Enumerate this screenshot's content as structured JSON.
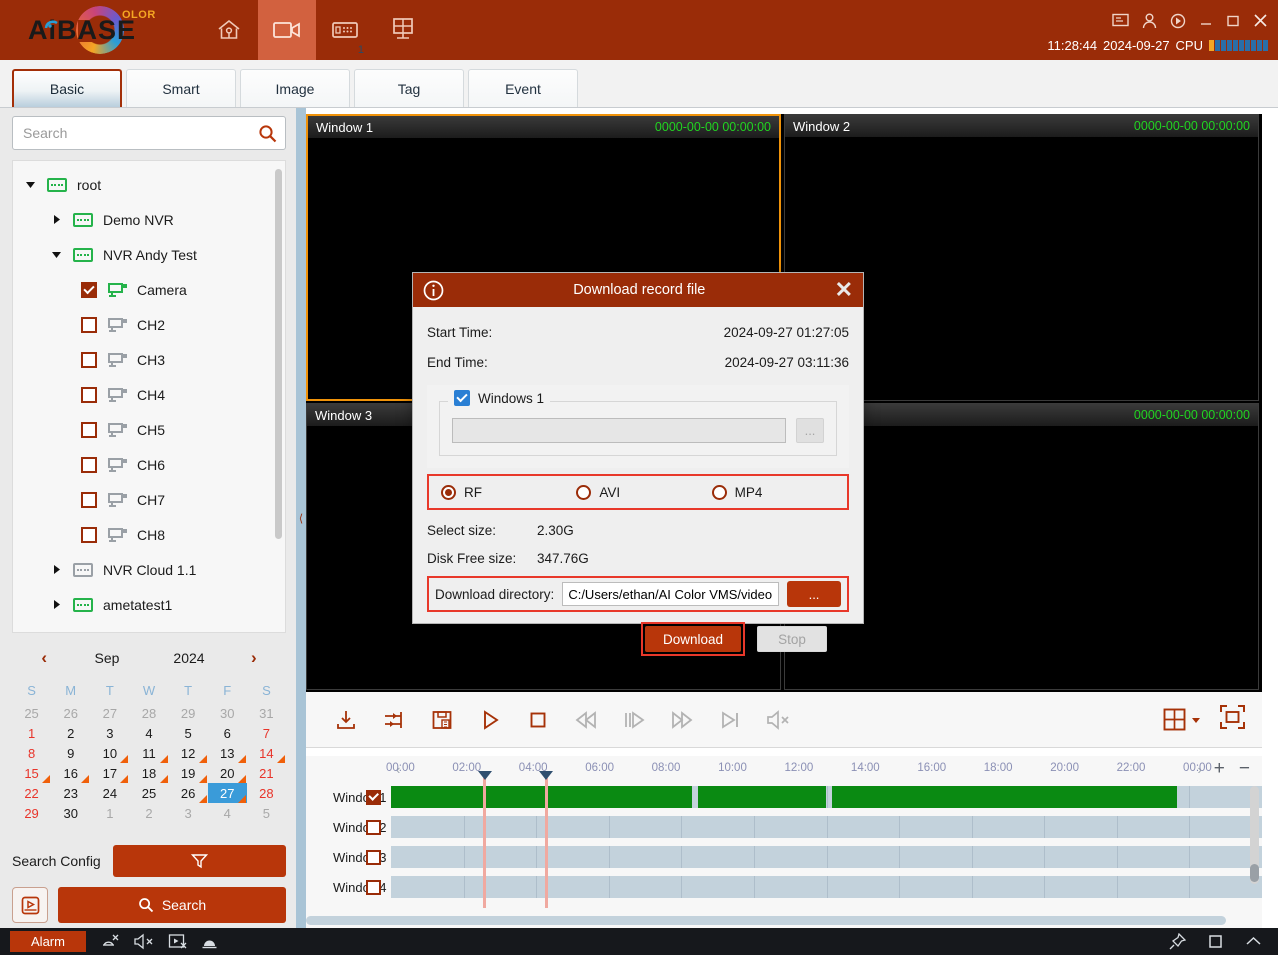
{
  "header": {
    "brand": "AiBASE",
    "brand_suffix": "OLOR",
    "nav": [
      {
        "name": "home-icon",
        "label": "Home",
        "active": false
      },
      {
        "name": "playback-camera-icon",
        "label": "Playback",
        "active": true
      },
      {
        "name": "device-icon",
        "label": "Device",
        "active": false
      },
      {
        "name": "layout-icon",
        "label": "Layout",
        "active": false
      }
    ],
    "nav_badge": "1",
    "window_controls": [
      "monitor-icon",
      "user-icon",
      "power-icon",
      "minimize-icon",
      "maximize-icon",
      "close-icon"
    ],
    "time": "11:28:44",
    "date": "2024-09-27",
    "cpu_label": "CPU",
    "cpu_bars": 10,
    "cpu_hot_bars": 1,
    "accent": "#9a2c08"
  },
  "tabs": [
    {
      "label": "Basic",
      "active": true
    },
    {
      "label": "Smart",
      "active": false
    },
    {
      "label": "Image",
      "active": false
    },
    {
      "label": "Tag",
      "active": false
    },
    {
      "label": "Event",
      "active": false
    }
  ],
  "sidebar": {
    "search_placeholder": "Search",
    "search_value": "",
    "tree": [
      {
        "label": "root",
        "depth": 0,
        "type": "nvr",
        "online": true,
        "expanded": true
      },
      {
        "label": "Demo NVR",
        "depth": 1,
        "type": "nvr",
        "online": true,
        "expanded": false
      },
      {
        "label": "NVR Andy Test",
        "depth": 1,
        "type": "nvr",
        "online": true,
        "expanded": true
      },
      {
        "label": "Camera",
        "depth": 2,
        "type": "camera",
        "online": true,
        "checked": true
      },
      {
        "label": "CH2",
        "depth": 2,
        "type": "camera",
        "online": false,
        "checked": false
      },
      {
        "label": "CH3",
        "depth": 2,
        "type": "camera",
        "online": false,
        "checked": false
      },
      {
        "label": "CH4",
        "depth": 2,
        "type": "camera",
        "online": false,
        "checked": false
      },
      {
        "label": "CH5",
        "depth": 2,
        "type": "camera",
        "online": false,
        "checked": false
      },
      {
        "label": "CH6",
        "depth": 2,
        "type": "camera",
        "online": false,
        "checked": false
      },
      {
        "label": "CH7",
        "depth": 2,
        "type": "camera",
        "online": false,
        "checked": false
      },
      {
        "label": "CH8",
        "depth": 2,
        "type": "camera",
        "online": false,
        "checked": false
      },
      {
        "label": "NVR Cloud 1.1",
        "depth": 1,
        "type": "nvr",
        "online": false,
        "expanded": false
      },
      {
        "label": "ametatest1",
        "depth": 1,
        "type": "nvr",
        "online": true,
        "expanded": false
      }
    ],
    "calendar": {
      "month": "Sep",
      "year": "2024",
      "prev": "‹",
      "next": "›",
      "dow": [
        "S",
        "M",
        "T",
        "W",
        "T",
        "F",
        "S"
      ],
      "days": [
        {
          "n": "25",
          "muted": true
        },
        {
          "n": "26",
          "muted": true
        },
        {
          "n": "27",
          "muted": true
        },
        {
          "n": "28",
          "muted": true
        },
        {
          "n": "29",
          "muted": true
        },
        {
          "n": "30",
          "muted": true
        },
        {
          "n": "31",
          "muted": true
        },
        {
          "n": "1",
          "weekend": true
        },
        {
          "n": "2"
        },
        {
          "n": "3"
        },
        {
          "n": "4"
        },
        {
          "n": "5"
        },
        {
          "n": "6"
        },
        {
          "n": "7",
          "weekend": true
        },
        {
          "n": "8",
          "weekend": true
        },
        {
          "n": "9"
        },
        {
          "n": "10",
          "rec": true
        },
        {
          "n": "11",
          "rec": true
        },
        {
          "n": "12",
          "rec": true
        },
        {
          "n": "13",
          "rec": true
        },
        {
          "n": "14",
          "weekend": true,
          "rec": true
        },
        {
          "n": "15",
          "weekend": true,
          "rec": true
        },
        {
          "n": "16",
          "rec": true
        },
        {
          "n": "17",
          "rec": true
        },
        {
          "n": "18",
          "rec": true
        },
        {
          "n": "19",
          "rec": true
        },
        {
          "n": "20",
          "rec": true
        },
        {
          "n": "21",
          "weekend": true
        },
        {
          "n": "22",
          "weekend": true
        },
        {
          "n": "23"
        },
        {
          "n": "24"
        },
        {
          "n": "25"
        },
        {
          "n": "26",
          "rec": true
        },
        {
          "n": "27",
          "selected": true,
          "rec": true
        },
        {
          "n": "28",
          "weekend": true
        },
        {
          "n": "29",
          "weekend": true
        },
        {
          "n": "30"
        },
        {
          "n": "1",
          "muted": true
        },
        {
          "n": "2",
          "muted": true
        },
        {
          "n": "3",
          "muted": true
        },
        {
          "n": "4",
          "muted": true
        },
        {
          "n": "5",
          "muted": true
        }
      ]
    },
    "search_config_label": "Search Config",
    "filter_button": "filter-icon",
    "disk_button": "disk-playback-icon",
    "search_button_label": "Search"
  },
  "video_windows": [
    {
      "title": "Window 1",
      "timestamp": "0000-00-00 00:00:00",
      "selected": true
    },
    {
      "title": "Window 2",
      "timestamp": "0000-00-00 00:00:00",
      "selected": false
    },
    {
      "title": "Window 3",
      "timestamp": "",
      "selected": false
    },
    {
      "title": "",
      "timestamp": "0000-00-00 00:00:00",
      "selected": false
    }
  ],
  "player_toolbar": {
    "left_icons": [
      {
        "name": "download-icon",
        "enabled": true
      },
      {
        "name": "clip-markers-icon",
        "enabled": true
      },
      {
        "name": "snapshot-save-icon",
        "enabled": true
      },
      {
        "name": "play-icon",
        "enabled": true
      },
      {
        "name": "stop-icon",
        "enabled": true
      },
      {
        "name": "rewind-icon",
        "enabled": false
      },
      {
        "name": "step-frame-icon",
        "enabled": false
      },
      {
        "name": "fast-forward-icon",
        "enabled": false
      },
      {
        "name": "next-frame-icon",
        "enabled": false
      },
      {
        "name": "mute-icon",
        "enabled": false
      }
    ],
    "right_icons": [
      {
        "name": "layout-grid-icon",
        "enabled": true
      },
      {
        "name": "fullscreen-icon",
        "enabled": true
      }
    ]
  },
  "timeline": {
    "ticks": [
      "00:00",
      "02:00",
      "04:00",
      "06:00",
      "08:00",
      "10:00",
      "12:00",
      "14:00",
      "16:00",
      "18:00",
      "20:00",
      "22:00",
      "00:00"
    ],
    "prev_arrow": "‹",
    "next_arrow": "›",
    "zoom_in": "+",
    "zoom_out": "−",
    "rows": [
      {
        "label": "Window1",
        "checked": true,
        "segments": [
          {
            "start": 0.0,
            "end": 16.6
          },
          {
            "start": 16.9,
            "end": 24.0
          },
          {
            "start": 24.3,
            "end": 43.3
          }
        ]
      },
      {
        "label": "Window2",
        "checked": false,
        "segments": []
      },
      {
        "label": "Window3",
        "checked": false,
        "segments": []
      },
      {
        "label": "Window4",
        "checked": false,
        "segments": []
      }
    ],
    "markers": [
      {
        "time": "01:27:05",
        "pos_pct": 5.8
      },
      {
        "time": "03:11:36",
        "pos_pct": 13.3
      }
    ]
  },
  "dialog": {
    "title": "Download record file",
    "info_icon": "info-icon",
    "close_icon": "close-icon",
    "start_time_label": "Start Time:",
    "start_time_value": "2024-09-27 01:27:05",
    "end_time_label": "End Time:",
    "end_time_value": "2024-09-27 03:11:36",
    "window_group_label": "Windows 1",
    "window_group_checked": true,
    "file_name_value": "",
    "file_browse_label": "...",
    "formats": [
      {
        "label": "RF",
        "selected": true
      },
      {
        "label": "AVI",
        "selected": false
      },
      {
        "label": "MP4",
        "selected": false
      }
    ],
    "select_size_label": "Select size:",
    "select_size_value": "2.30G",
    "disk_free_label": "Disk Free size:",
    "disk_free_value": "347.76G",
    "download_dir_label": "Download directory:",
    "download_dir_value": "C:/Users/ethan/AI Color VMS/video",
    "download_dir_browse": "...",
    "download_button": "Download",
    "stop_button": "Stop",
    "highlight_color": "#e8382a"
  },
  "statusbar": {
    "alarm_label": "Alarm",
    "left_icons": [
      "alarm-off-icon",
      "mute-icon",
      "screen-record-off-icon",
      "bell-icon"
    ],
    "right_icons": [
      "pin-icon",
      "window-icon",
      "chevron-up-icon"
    ]
  }
}
